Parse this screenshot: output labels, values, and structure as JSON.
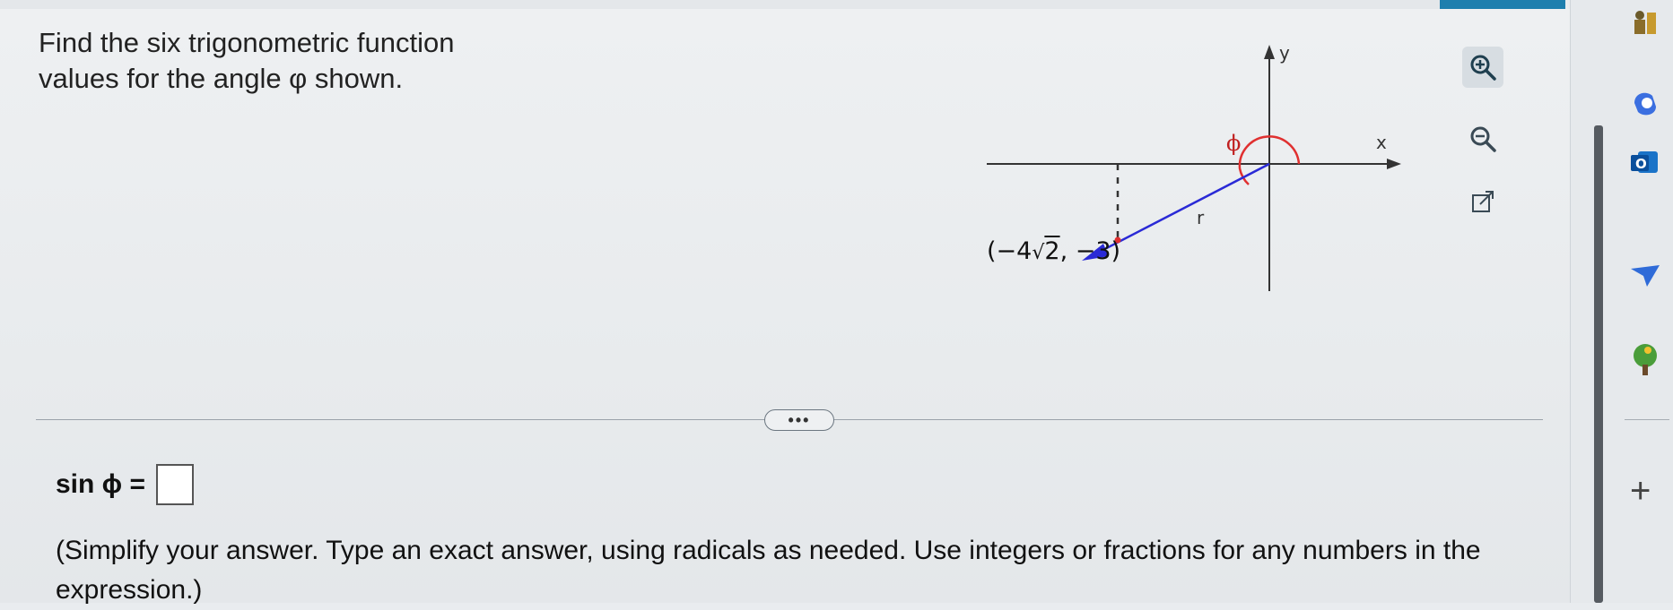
{
  "problem": {
    "prompt": "Find the six trigonometric function values for the angle φ shown."
  },
  "graph": {
    "y_axis_label": "y",
    "x_axis_label": "x",
    "angle_label": "ϕ",
    "radius_label": "r",
    "point_label_prefix": "(−4",
    "point_label_sqrt": "2",
    "point_label_suffix": ", −3)",
    "colors": {
      "axes": "#333333",
      "ray": "#2a2ad6",
      "angle_arc": "#e03030",
      "dashed": "#333333"
    },
    "tools": {
      "zoom_in_icon": "zoom-in-icon",
      "zoom_out_icon": "zoom-out-icon",
      "popout_icon": "external-link-icon"
    }
  },
  "divider": {
    "more_label": "•••"
  },
  "answer": {
    "function_label": "sin ϕ =",
    "input_value": ""
  },
  "instructions": "(Simplify your answer. Type an exact answer, using radicals as needed. Use integers or fractions for any numbers in the expression.)",
  "sidebar": {
    "icons": [
      "chess-icon",
      "copilot-icon",
      "outlook-icon",
      "send-icon",
      "tree-icon",
      "add-icon"
    ],
    "plus_label": "+"
  }
}
